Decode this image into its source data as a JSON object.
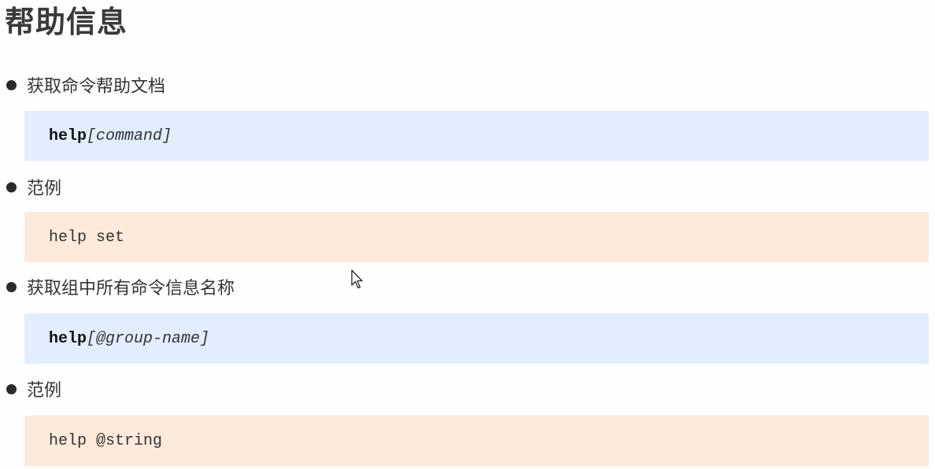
{
  "title": "帮助信息",
  "sections": [
    {
      "bullet": "获取命令帮助文档",
      "code": {
        "kind": "syntax",
        "keyword": "help",
        "argument": "[command]"
      }
    },
    {
      "bullet": "范例",
      "code": {
        "kind": "example",
        "text": "help set"
      }
    },
    {
      "bullet": "获取组中所有命令信息名称",
      "code": {
        "kind": "syntax",
        "keyword": "help",
        "argument": "[@group-name]"
      }
    },
    {
      "bullet": "范例",
      "code": {
        "kind": "example",
        "text": "help @string"
      }
    }
  ],
  "colors": {
    "syntax_block": "#e2edfd",
    "example_block": "#fdeadb",
    "text": "#333333"
  },
  "icons": {
    "cursor": "mouse-pointer-icon"
  }
}
